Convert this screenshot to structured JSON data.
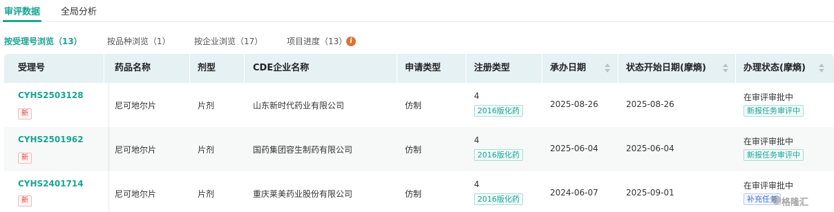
{
  "top_tabs": [
    {
      "label": "审评数据",
      "active": true
    },
    {
      "label": "全局分析",
      "active": false
    }
  ],
  "sub_tabs": [
    {
      "label": "按受理号浏览（13）",
      "active": true
    },
    {
      "label": "按品种浏览（1）",
      "active": false
    },
    {
      "label": "按企业浏览（17）",
      "active": false
    },
    {
      "label": "项目进度（13）",
      "active": false
    }
  ],
  "info_icon": "info-icon",
  "table": {
    "columns": [
      {
        "label": "受理号",
        "sortable": false
      },
      {
        "label": "药品名称",
        "sortable": false
      },
      {
        "label": "剂型",
        "sortable": false
      },
      {
        "label": "CDE企业名称",
        "sortable": false
      },
      {
        "label": "申请类型",
        "sortable": false
      },
      {
        "label": "注册类型",
        "sortable": false
      },
      {
        "label": "承办日期",
        "sortable": true
      },
      {
        "label": "状态开始日期(摩熵)",
        "sortable": true
      },
      {
        "label": "办理状态(摩熵)",
        "sortable": true
      }
    ],
    "rows": [
      {
        "id": "CYHS2503128",
        "badge": "新",
        "drug": "尼可地尔片",
        "form": "片剂",
        "company": "山东新时代药业有限公司",
        "apply_type": "仿制",
        "reg_class": "4",
        "reg_tag": "2016版化药",
        "accept_date": "2025-08-26",
        "status_date": "2025-08-26",
        "status": "在审评审批中",
        "status_tag": "新报任务审评中",
        "status_tag_color": "#1aa394"
      },
      {
        "id": "CYHS2501962",
        "badge": "新",
        "drug": "尼可地尔片",
        "form": "片剂",
        "company": "国药集团容生制药有限公司",
        "apply_type": "仿制",
        "reg_class": "4",
        "reg_tag": "2016版化药",
        "accept_date": "2025-06-04",
        "status_date": "2025-06-04",
        "status": "在审评审批中",
        "status_tag": "新报任务审评中",
        "status_tag_color": "#1aa394"
      },
      {
        "id": "CYHS2401714",
        "badge": "新",
        "drug": "尼可地尔片",
        "form": "片剂",
        "company": "重庆莱美药业股份有限公司",
        "apply_type": "仿制",
        "reg_class": "4",
        "reg_tag": "2016版化药",
        "accept_date": "2024-06-07",
        "status_date": "2025-09-01",
        "status": "在审评审批中",
        "status_tag": "补充任务",
        "status_tag_color": "#3a6fd8"
      }
    ]
  },
  "watermark": "格隆汇",
  "colors": {
    "accent": "#1aa394",
    "header_bg": "#e6f1f3",
    "badge_red": "#e23b3b",
    "info_orange": "#e0703a"
  }
}
